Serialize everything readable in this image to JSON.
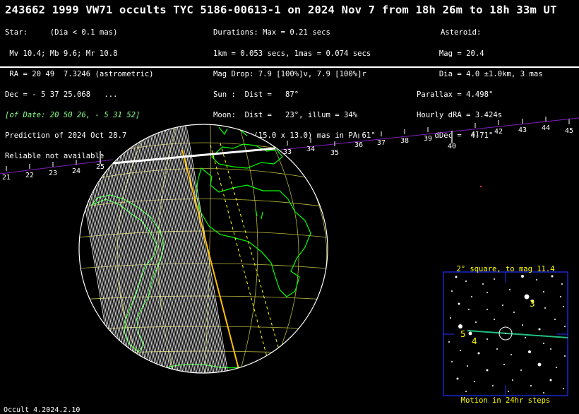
{
  "title": "243662 1999 VW71 occults TYC 5186-00613-1 on 2024 Nov  7 from 18h 26m to 18h 33m UT",
  "star_block": [
    "Star:     (Dia < 0.1 mas)",
    " Mv 10.4; Mb 9.6; Mr 10.8",
    " RA = 20 49  7.3246 (astrometric)",
    "Dec = - 5 37 25.068   ...",
    "[of Date: 20 50 26, - 5 31 52]",
    "Prediction of 2024 Oct 28.7",
    "Reliable not available"
  ],
  "event_block": [
    "Durations: Max = 0.21 secs",
    "1km = 0.053 secs, 1mas = 0.074 secs",
    "Mag Drop: 7.9 [100%]v, 7.9 [100%]r",
    "Sun :  Dist =   87°",
    "Moon:  Dist =   23°, illum = 34%",
    "1σ Err: ±(15.0 x 13.0) mas in PA 61°"
  ],
  "asteroid_block": [
    "Asteroid:",
    "     Mag = 20.4",
    "     Dia = 4.0 ±1.0km, 3 mas",
    "Parallax = 4.498\"",
    "Hourly dRA = 3.424s",
    "    dDec =  4.71\""
  ],
  "footer": "Occult 4.2024.2.10",
  "path_ticks": [
    "21",
    "22",
    "23",
    "24",
    "25",
    "33",
    "34",
    "35",
    "36",
    "37",
    "38",
    "39",
    "40",
    "41",
    "42",
    "43",
    "44",
    "45"
  ],
  "inset": {
    "title": "2° square, to mag 11.4",
    "caption": "Motion in 24hr steps",
    "labels": [
      "3",
      "4",
      "5"
    ]
  },
  "colors": {
    "land": "#00ff00",
    "grid": "#b8b840",
    "centerline": "#ffc000",
    "error_line": "#ffff00",
    "path_line": "#8020c0",
    "inset_border": "#2030ff"
  }
}
